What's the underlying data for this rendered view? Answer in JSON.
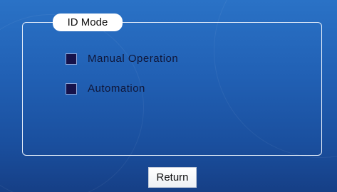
{
  "panel": {
    "title": "ID Mode"
  },
  "options": [
    {
      "label": "Manual Operation",
      "checked": false
    },
    {
      "label": "Automation",
      "checked": false
    }
  ],
  "footer": {
    "return_label": "Return"
  },
  "colors": {
    "background_top": "#2a72c6",
    "background_bottom": "#163f86",
    "checkbox_fill": "#16124a",
    "text_dark": "#0f1638"
  }
}
